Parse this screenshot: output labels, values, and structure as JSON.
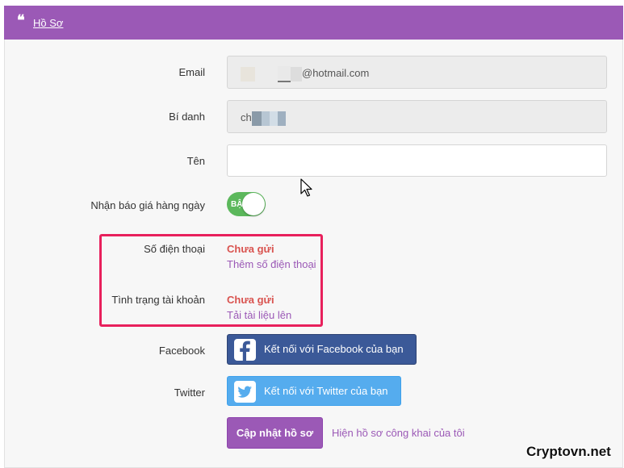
{
  "header": {
    "title": "Hồ Sơ",
    "icon": "quote-icon"
  },
  "form": {
    "email": {
      "label": "Email",
      "value": "@hotmail.com"
    },
    "alias": {
      "label": "Bí danh",
      "value": "ch"
    },
    "name": {
      "label": "Tên",
      "value": ""
    },
    "price_alert": {
      "label": "Nhận báo giá hàng ngày",
      "toggle_text": "BẬ",
      "state": "on"
    },
    "phone": {
      "label": "Số điện thoại",
      "status": "Chưa gửi",
      "action": "Thêm số điện thoại"
    },
    "account_status": {
      "label": "Tình trạng tài khoản",
      "status": "Chưa gửi",
      "action": "Tải tài liệu lên"
    },
    "facebook": {
      "label": "Facebook",
      "button": "Kết nối với Facebook của bạn"
    },
    "twitter": {
      "label": "Twitter",
      "button": "Kết nối với Twitter của bạn"
    },
    "update_button": "Cập nhật hồ sơ",
    "public_profile_link": "Hiện hồ sơ công khai của tôi"
  },
  "watermark": "Cryptovn.net",
  "colors": {
    "accent": "#9b59b6",
    "facebook": "#3b5998",
    "twitter": "#55acee",
    "toggle_on": "#5cb85c",
    "status_red": "#d9534f",
    "highlight_box": "#e8205c"
  }
}
